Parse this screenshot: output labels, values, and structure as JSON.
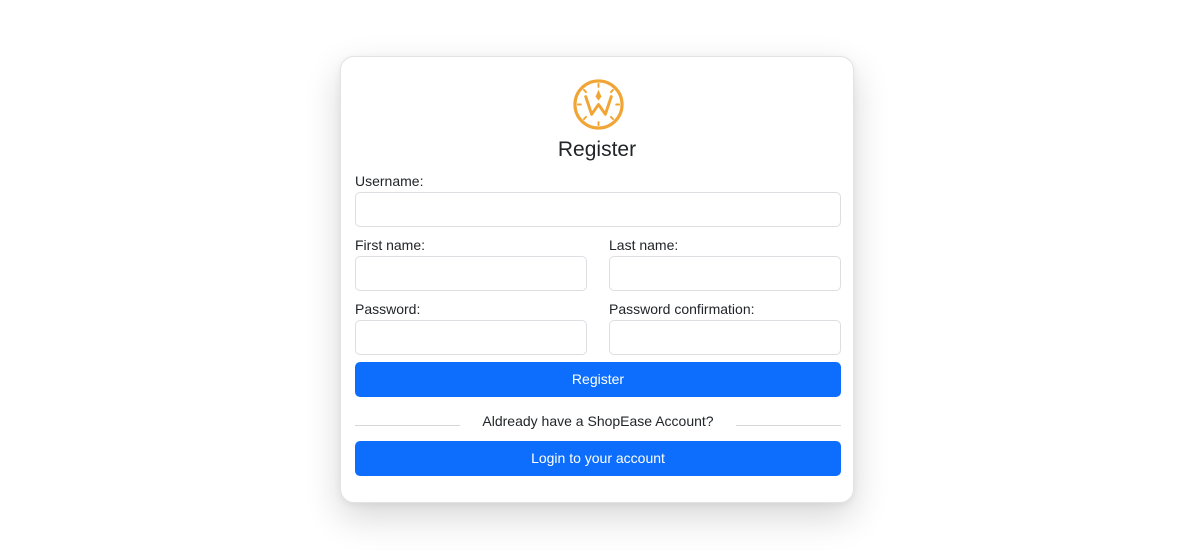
{
  "form": {
    "title": "Register",
    "username_label": "Username:",
    "username_value": "",
    "first_name_label": "First name:",
    "first_name_value": "",
    "last_name_label": "Last name:",
    "last_name_value": "",
    "password_label": "Password:",
    "password_value": "",
    "password_confirmation_label": "Password confirmation:",
    "password_confirmation_value": "",
    "register_button_label": "Register",
    "divider_text": "Aldready have a ShopEase Account?",
    "login_button_label": "Login to your account"
  },
  "colors": {
    "logo": "#f0a534",
    "primary_button": "#0d6efd",
    "button_text": "#ffffff",
    "input_border": "#dcdee2"
  },
  "icons": {
    "logo": "shopease-logo-icon"
  }
}
